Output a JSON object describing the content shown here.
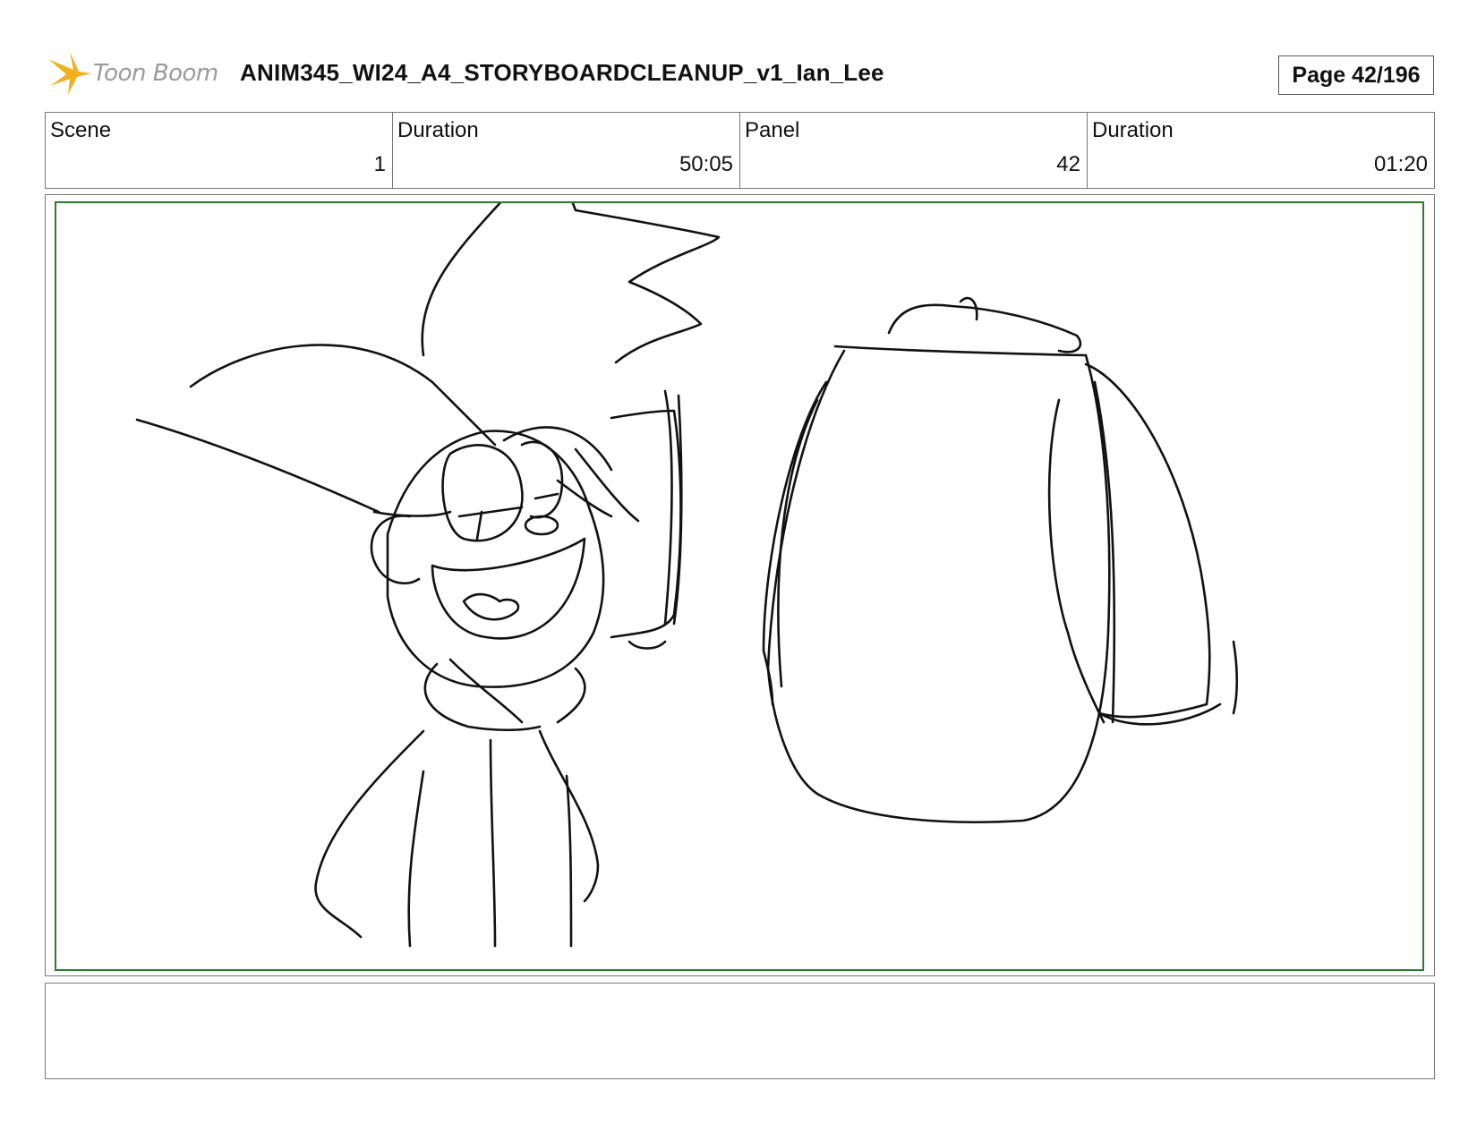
{
  "header": {
    "logo_text": "Toon Boom",
    "doc_title": "ANIM345_WI24_A4_STORYBOARDCLEANUP_v1_Ian_Lee",
    "page_label": "Page",
    "page_value": "42/196"
  },
  "info": {
    "scene_label": "Scene",
    "scene_value": "1",
    "scene_duration_label": "Duration",
    "scene_duration_value": "50:05",
    "panel_label": "Panel",
    "panel_value": "42",
    "panel_duration_label": "Duration",
    "panel_duration_value": "01:20"
  },
  "colors": {
    "safe_frame": "#2f7a2f",
    "logo_star": "#f2b01e"
  },
  "icons": {
    "logo": "toon-boom-star-icon"
  }
}
